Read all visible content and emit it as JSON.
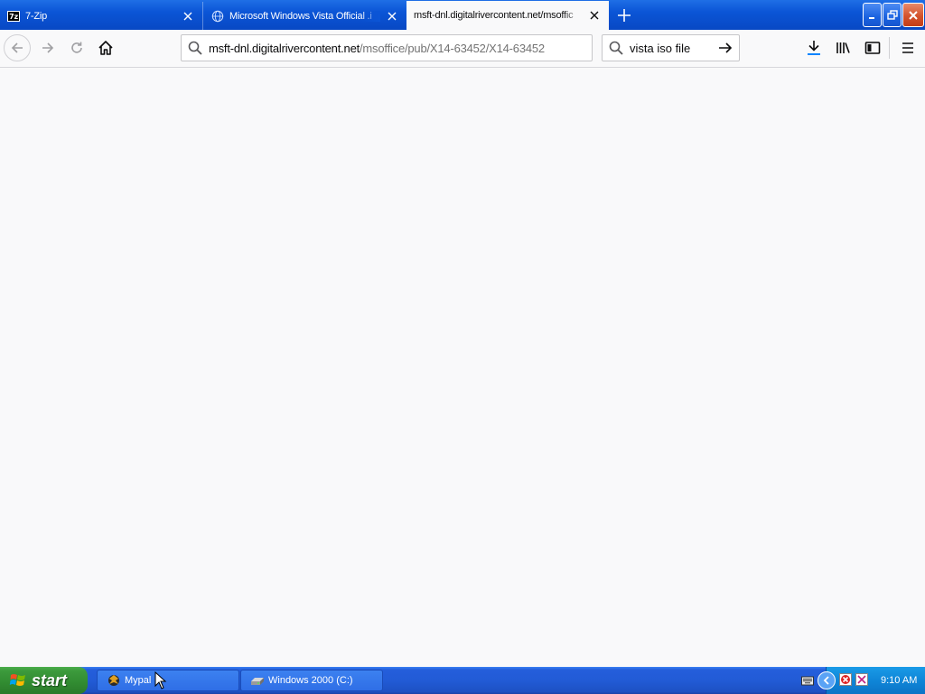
{
  "browser": {
    "tabs": [
      {
        "title": "7-Zip",
        "icon": "7zip-icon",
        "active": false
      },
      {
        "title": "Microsoft Windows Vista Official .i",
        "icon": "globe-icon",
        "active": false
      },
      {
        "title": "msft-dnl.digitalrivercontent.net/msoffic",
        "icon": "",
        "active": true
      }
    ],
    "url_host": "msft-dnl.digitalrivercontent.net",
    "url_path": "/msoffice/pub/X14-63452/X14-63452",
    "search_value": "vista iso file"
  },
  "taskbar": {
    "start_label": "start",
    "tasks": [
      {
        "label": "Mypal",
        "icon": "mypal-icon"
      },
      {
        "label": "Windows 2000 (C:)",
        "icon": "drive-icon"
      }
    ],
    "clock": "9:10 AM"
  },
  "colors": {
    "taskbar_blue": "#245edb",
    "start_green": "#3c9a3c",
    "tray_blue": "#0f86d8",
    "page_background": "#f9f9fa"
  }
}
